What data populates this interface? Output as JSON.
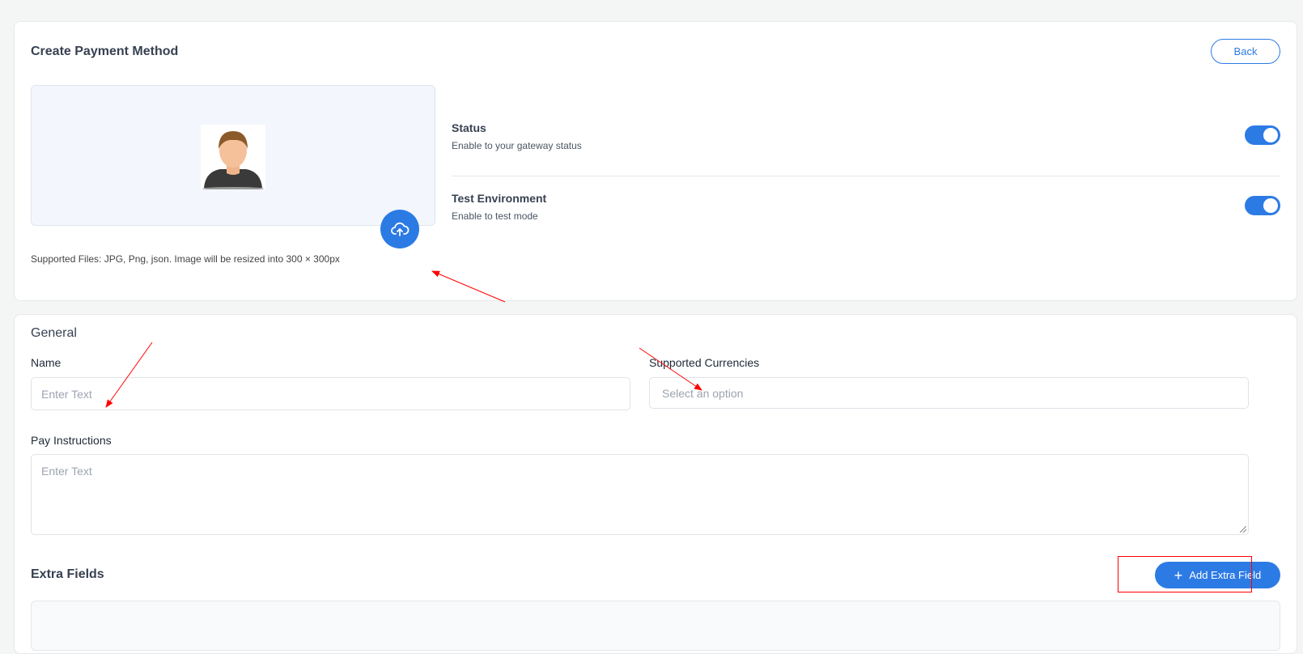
{
  "header": {
    "title": "Create Payment Method",
    "back_label": "Back"
  },
  "upload": {
    "hint": "Supported Files: JPG, Png, json. Image will be resized into 300 × 300px"
  },
  "settings": [
    {
      "label": "Status",
      "description": "Enable to your gateway status",
      "enabled": true
    },
    {
      "label": "Test Environment",
      "description": "Enable to test mode",
      "enabled": true
    }
  ],
  "general": {
    "title": "General",
    "name_label": "Name",
    "name_placeholder": "Enter Text",
    "currencies_label": "Supported Currencies",
    "currencies_placeholder": "Select an option",
    "instructions_label": "Pay Instructions",
    "instructions_placeholder": "Enter Text"
  },
  "extra_fields": {
    "title": "Extra Fields",
    "add_label": "Add Extra Field"
  },
  "colors": {
    "accent": "#2c7be5",
    "annotation": "#ff0000"
  },
  "icons": [
    "upload-cloud-icon",
    "plus-icon",
    "avatar-icon"
  ]
}
